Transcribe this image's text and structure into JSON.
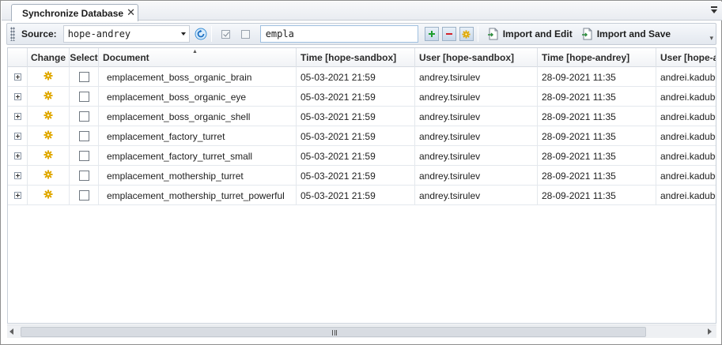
{
  "tab": {
    "title": "Synchronize Database",
    "close_glyph": "✕"
  },
  "toolbar": {
    "source_label": "Source:",
    "source_value": "hope-andrey",
    "filter_value": "empla",
    "import_edit_label": "Import and Edit",
    "import_save_label": "Import and Save",
    "accent_add": "#1e9e2e",
    "accent_remove": "#d4232b",
    "accent_changed": "#e0a800"
  },
  "grid": {
    "columns": [
      "Change",
      "Select",
      "Document",
      "Time [hope-sandbox]",
      "User [hope-sandbox]",
      "Time [hope-andrey]",
      "User [hope-andrey]"
    ],
    "rows": [
      {
        "change": "changed-icon",
        "document": "emplacement_boss_organic_brain",
        "time_sandbox": "05-03-2021 21:59",
        "user_sandbox": "andrey.tsirulev",
        "time_andrey": "28-09-2021 11:35",
        "user_andrey": "andrei.kadubovskii"
      },
      {
        "change": "changed-icon",
        "document": "emplacement_boss_organic_eye",
        "time_sandbox": "05-03-2021 21:59",
        "user_sandbox": "andrey.tsirulev",
        "time_andrey": "28-09-2021 11:35",
        "user_andrey": "andrei.kadubovskii"
      },
      {
        "change": "changed-icon",
        "document": "emplacement_boss_organic_shell",
        "time_sandbox": "05-03-2021 21:59",
        "user_sandbox": "andrey.tsirulev",
        "time_andrey": "28-09-2021 11:35",
        "user_andrey": "andrei.kadubovskii"
      },
      {
        "change": "changed-icon",
        "document": "emplacement_factory_turret",
        "time_sandbox": "05-03-2021 21:59",
        "user_sandbox": "andrey.tsirulev",
        "time_andrey": "28-09-2021 11:35",
        "user_andrey": "andrei.kadubovskii"
      },
      {
        "change": "changed-icon",
        "document": "emplacement_factory_turret_small",
        "time_sandbox": "05-03-2021 21:59",
        "user_sandbox": "andrey.tsirulev",
        "time_andrey": "28-09-2021 11:35",
        "user_andrey": "andrei.kadubovskii"
      },
      {
        "change": "changed-icon",
        "document": "emplacement_mothership_turret",
        "time_sandbox": "05-03-2021 21:59",
        "user_sandbox": "andrey.tsirulev",
        "time_andrey": "28-09-2021 11:35",
        "user_andrey": "andrei.kadubovskii"
      },
      {
        "change": "changed-icon",
        "document": "emplacement_mothership_turret_powerful",
        "time_sandbox": "05-03-2021 21:59",
        "user_sandbox": "andrey.tsirulev",
        "time_andrey": "28-09-2021 11:35",
        "user_andrey": "andrei.kadubovskii"
      }
    ]
  }
}
